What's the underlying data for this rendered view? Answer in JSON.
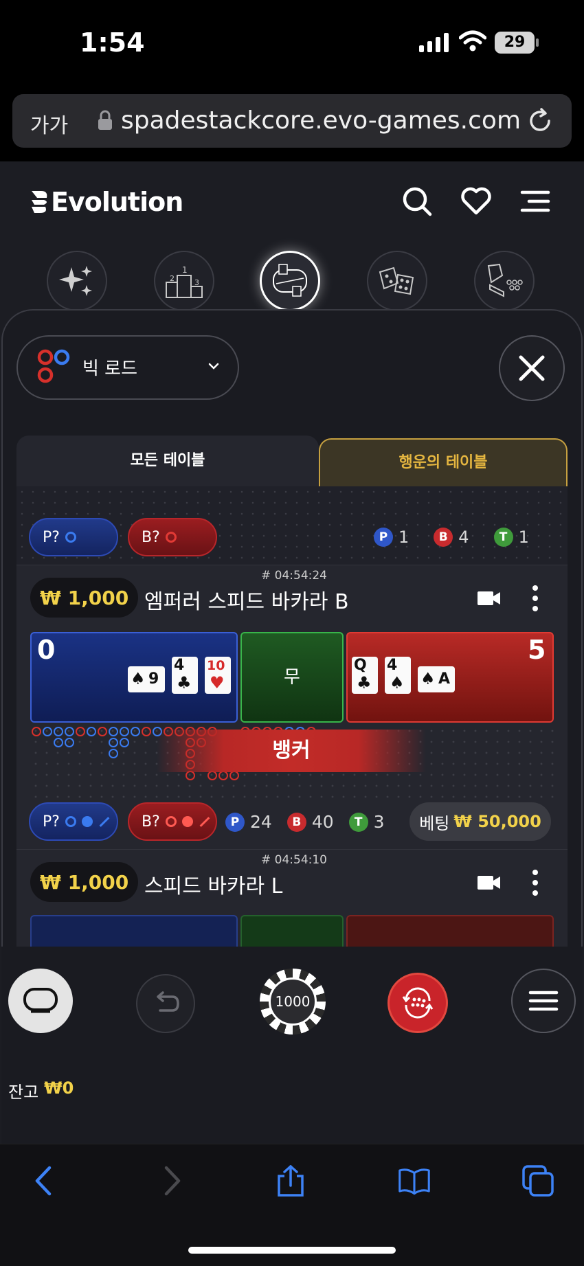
{
  "status_bar": {
    "time": "1:54",
    "battery": "29"
  },
  "browser": {
    "text_size_label": "가가",
    "url": "spadestackcore.evo-games.com"
  },
  "site": {
    "logo": "Evolution"
  },
  "panel": {
    "road_selector": "빅 로드",
    "tabs": {
      "all": "모든 테이블",
      "lucky": "행운의 테이블"
    },
    "summary_row": {
      "player_pill": "P?",
      "banker_pill": "B?",
      "counts": {
        "p_badge": "P",
        "p": "1",
        "b_badge": "B",
        "b": "4",
        "t_badge": "T",
        "t": "1"
      }
    },
    "tables": [
      {
        "id": "# 04:54:24",
        "limit": "₩ 1,000",
        "name": "엠퍼러 스피드 바카라 B",
        "player_score": "0",
        "tie_label": "무",
        "banker_score": "5",
        "player_cards": [
          {
            "rank": "9",
            "suit": "♠"
          },
          {
            "rank": "4",
            "suit": "♣"
          },
          {
            "rank": "10",
            "suit": "♥"
          }
        ],
        "banker_cards": [
          {
            "rank": "Q",
            "suit": "♣"
          },
          {
            "rank": "4",
            "suit": "♠"
          },
          {
            "rank": "A",
            "suit": "♠"
          }
        ],
        "winner_label": "뱅커",
        "player_pill": "P?",
        "banker_pill": "B?",
        "counts": {
          "p_badge": "P",
          "p": "24",
          "b_badge": "B",
          "b": "40",
          "t_badge": "T",
          "t": "3"
        },
        "bet_label": "베팅",
        "bet_amount": "₩ 50,000"
      },
      {
        "id": "# 04:54:10",
        "limit": "₩ 1,000",
        "name": "스피드 바카라 L"
      }
    ]
  },
  "controls": {
    "chip_value": "1000"
  },
  "balance": {
    "label": "잔고",
    "amount": "₩0"
  },
  "colors": {
    "player_blue": "#2f57c9",
    "banker_red": "#c82b2e",
    "tie_green": "#3f9b3b",
    "gold": "#f2d24a"
  }
}
